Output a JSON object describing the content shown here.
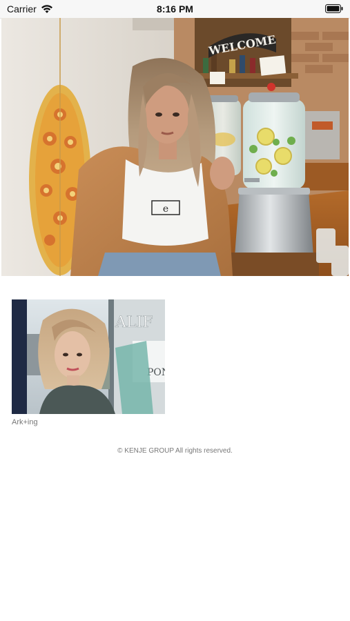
{
  "status_bar": {
    "carrier": "Carrier",
    "time": "8:16 PM",
    "wifi_icon": "wifi-icon",
    "battery_icon": "battery-icon"
  },
  "hero": {
    "image": "salon-interior-photo",
    "sign_text": "WELCOME",
    "shirt_text": "e"
  },
  "salons": [
    {
      "name": "Ark+ing",
      "image": "stylist-portrait-photo",
      "window_text_top": "ALIF",
      "window_text_bottom": "PON"
    }
  ],
  "footer": {
    "copyright": "© KENJE GROUP All rights reserved."
  }
}
